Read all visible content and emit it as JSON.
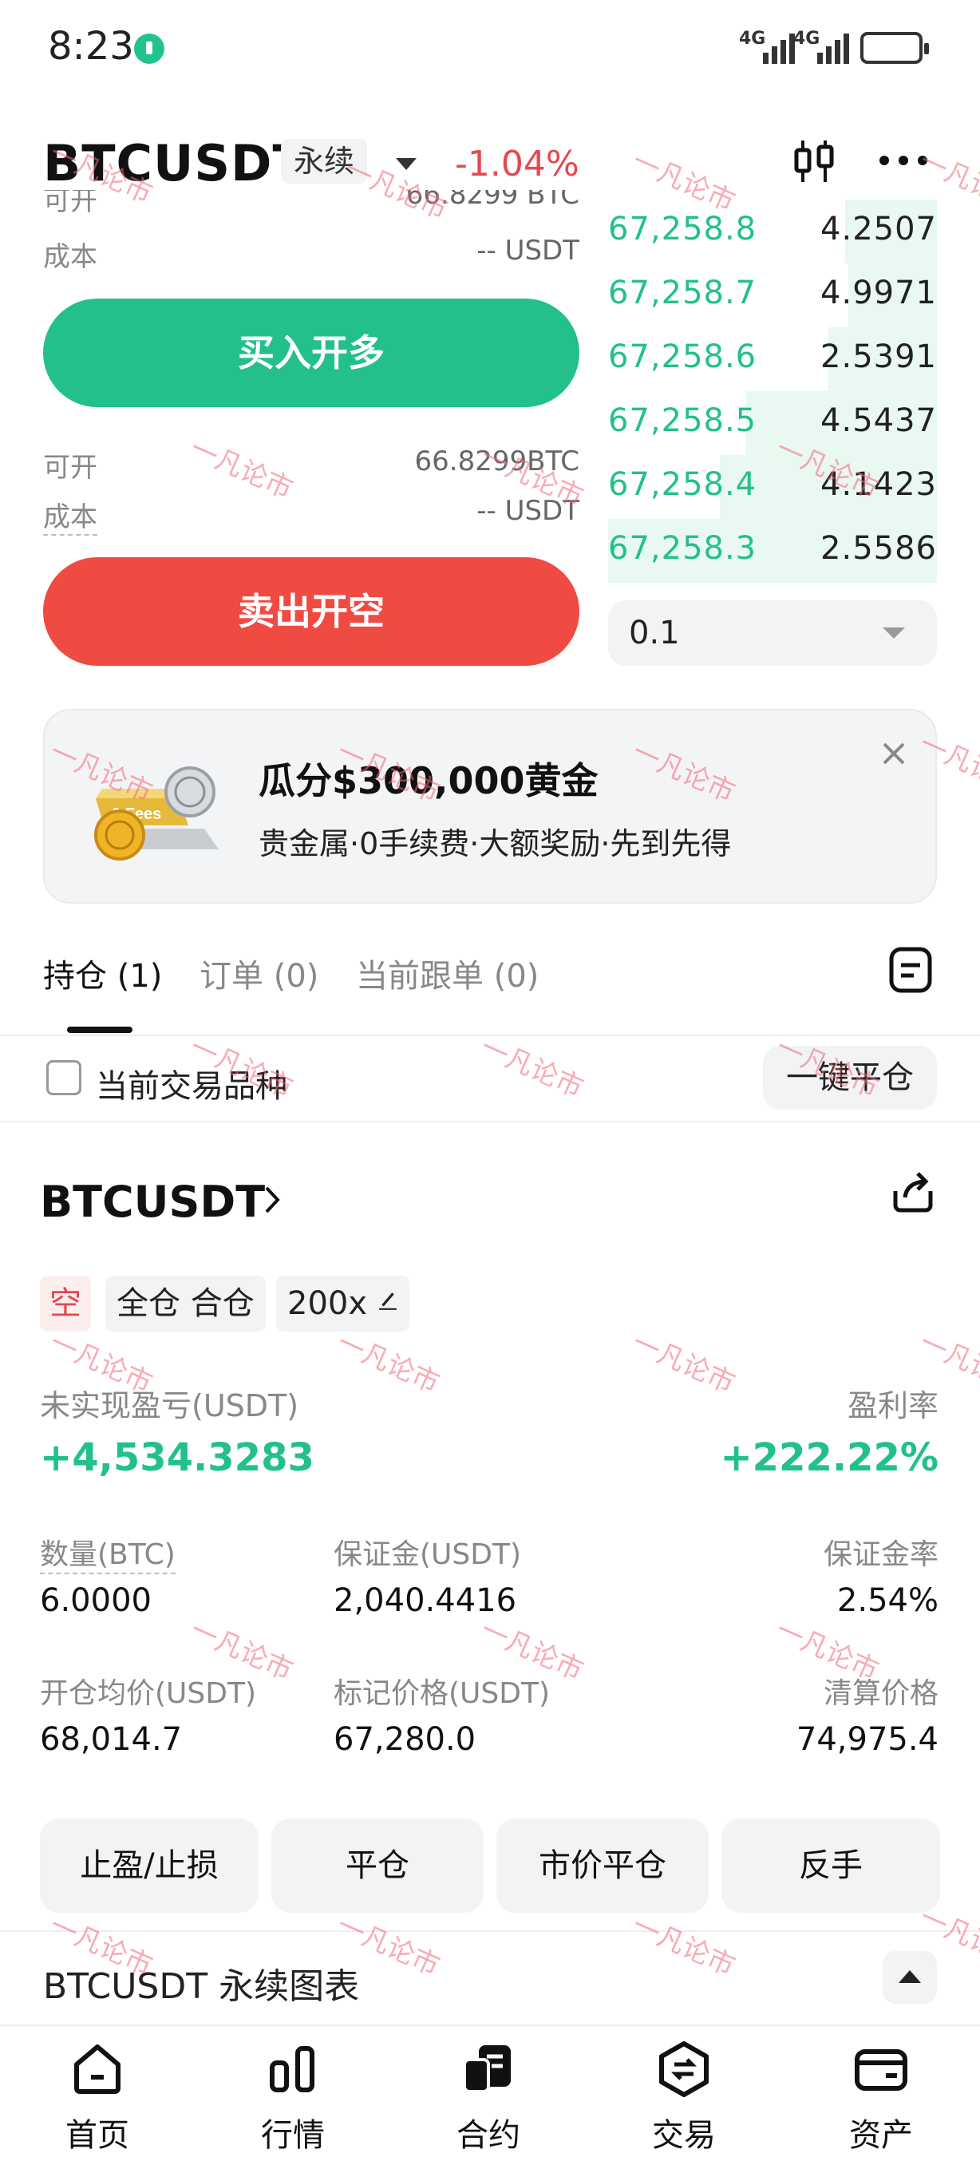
{
  "status_bar": {
    "time": "8:23",
    "signal1": "4G",
    "signal2": "4G"
  },
  "header": {
    "symbol": "BTCUSDT",
    "contract_type": "永续",
    "change": "-1.04%"
  },
  "order_panel": {
    "top_partial": {
      "available_label": "可开",
      "available_value": "66.8299 BTC",
      "cost_label": "成本",
      "cost_value": "-- USDT"
    },
    "buy_button": "买入开多",
    "sell_info": {
      "available_label": "可开",
      "available_value": "66.8299BTC",
      "cost_label": "成本",
      "cost_value": "-- USDT"
    },
    "sell_button": "卖出开空"
  },
  "order_book": {
    "bids": [
      {
        "price": "67,258.8",
        "qty": "4.2507",
        "depth": 0.28
      },
      {
        "price": "67,258.7",
        "qty": "4.9971",
        "depth": 0.27
      },
      {
        "price": "67,258.6",
        "qty": "2.5391",
        "depth": 0.33
      },
      {
        "price": "67,258.5",
        "qty": "4.5437",
        "depth": 0.58
      },
      {
        "price": "67,258.4",
        "qty": "4.1423",
        "depth": 0.66
      },
      {
        "price": "67,258.3",
        "qty": "2.5586",
        "depth": 1.0
      }
    ],
    "precision": "0.1"
  },
  "promo": {
    "title": "瓜分$300,000黄金",
    "subtitle": "贵金属·0手续费·大额奖励·先到先得",
    "badge": "0 Fees"
  },
  "tabs": [
    {
      "label": "持仓 (1)"
    },
    {
      "label": "订单 (0)"
    },
    {
      "label": "当前跟单 (0)"
    }
  ],
  "filter": {
    "label": "当前交易品种",
    "close_all": "一键平仓"
  },
  "position": {
    "symbol": "BTCUSDT",
    "side": "空",
    "margin_mode": "全仓 合仓",
    "leverage": "200x",
    "pnl_label": "未实现盈亏(USDT)",
    "pnl_value": "+4,534.3283",
    "roi_label": "盈利率",
    "roi_value": "+222.22%",
    "size_label": "数量(BTC)",
    "size_value": "6.0000",
    "margin_label": "保证金(USDT)",
    "margin_value": "2,040.4416",
    "margin_ratio_label": "保证金率",
    "margin_ratio_value": "2.54%",
    "entry_label": "开仓均价(USDT)",
    "entry_value": "68,014.7",
    "mark_label": "标记价格(USDT)",
    "mark_value": "67,280.0",
    "liq_label": "清算价格",
    "liq_value": "74,975.4",
    "actions": [
      "止盈/止损",
      "平仓",
      "市价平仓",
      "反手"
    ]
  },
  "chart_bar": {
    "label": "BTCUSDT 永续图表"
  },
  "nav": [
    {
      "label": "首页",
      "icon": "home-icon"
    },
    {
      "label": "行情",
      "icon": "market-icon"
    },
    {
      "label": "合约",
      "icon": "futures-icon"
    },
    {
      "label": "交易",
      "icon": "trade-icon"
    },
    {
      "label": "资产",
      "icon": "wallet-icon"
    }
  ],
  "watermark": "一凡论市",
  "colors": {
    "up": "#23c08a",
    "down": "#ef4b43",
    "accent_text": "#e5484d"
  }
}
